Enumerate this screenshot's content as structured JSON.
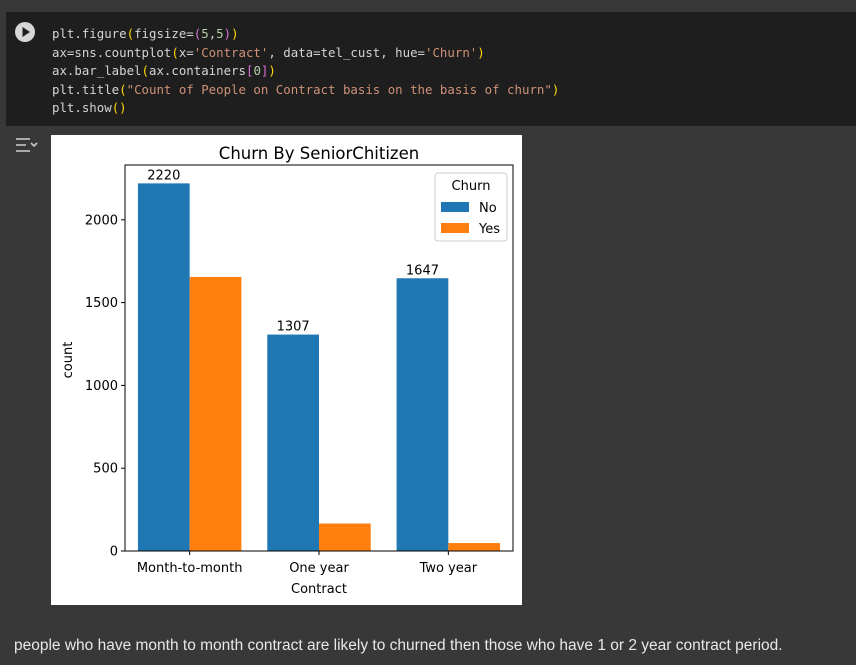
{
  "code_cell": {
    "lines": [
      [
        {
          "t": "plt.figure",
          "c": ""
        },
        {
          "t": "(",
          "c": "c-p1"
        },
        {
          "t": "figsize=",
          "c": ""
        },
        {
          "t": "(",
          "c": "c-p2"
        },
        {
          "t": "5",
          "c": "c-num"
        },
        {
          "t": ",",
          "c": ""
        },
        {
          "t": "5",
          "c": "c-num"
        },
        {
          "t": ")",
          "c": "c-p2"
        },
        {
          "t": ")",
          "c": "c-p1"
        }
      ],
      [
        {
          "t": "ax=sns.countplot",
          "c": ""
        },
        {
          "t": "(",
          "c": "c-p1"
        },
        {
          "t": "x=",
          "c": ""
        },
        {
          "t": "'Contract'",
          "c": "c-str"
        },
        {
          "t": ", data=tel_cust, hue=",
          "c": ""
        },
        {
          "t": "'Churn'",
          "c": "c-str"
        },
        {
          "t": ")",
          "c": "c-p1"
        }
      ],
      [
        {
          "t": "ax.bar_label",
          "c": ""
        },
        {
          "t": "(",
          "c": "c-p1"
        },
        {
          "t": "ax.containers",
          "c": ""
        },
        {
          "t": "[",
          "c": "c-p2"
        },
        {
          "t": "0",
          "c": "c-num"
        },
        {
          "t": "]",
          "c": "c-p2"
        },
        {
          "t": ")",
          "c": "c-p1"
        }
      ],
      [
        {
          "t": "plt.title",
          "c": ""
        },
        {
          "t": "(",
          "c": "c-p1"
        },
        {
          "t": "\"Count of People on Contract basis on the basis of churn\"",
          "c": "c-str"
        },
        {
          "t": ")",
          "c": "c-p1"
        }
      ],
      [
        {
          "t": "plt.show",
          "c": ""
        },
        {
          "t": "(",
          "c": "c-p1"
        },
        {
          "t": ")",
          "c": "c-p1"
        }
      ]
    ],
    "run_icon": "play-icon"
  },
  "output": {
    "toggle_icon": "output-toggle-icon"
  },
  "chart_data": {
    "type": "bar",
    "title": "Churn By SeniorChitizen",
    "xlabel": "Contract",
    "ylabel": "count",
    "categories": [
      "Month-to-month",
      "One year",
      "Two year"
    ],
    "series": [
      {
        "name": "No",
        "color": "#1f77b4",
        "values": [
          2220,
          1307,
          1647
        ]
      },
      {
        "name": "Yes",
        "color": "#ff7f0e",
        "values": [
          1655,
          166,
          48
        ]
      }
    ],
    "bar_labels": [
      "2220",
      "1307",
      "1647"
    ],
    "ylim": [
      0,
      2331
    ],
    "yticks": [
      0,
      500,
      1000,
      1500,
      2000
    ],
    "legend": {
      "title": "Churn",
      "placement": "top-right"
    },
    "grid": false
  },
  "markdown": {
    "text": "people who have month to month contract are likely to churned then those who have 1 or 2 year contract period."
  }
}
